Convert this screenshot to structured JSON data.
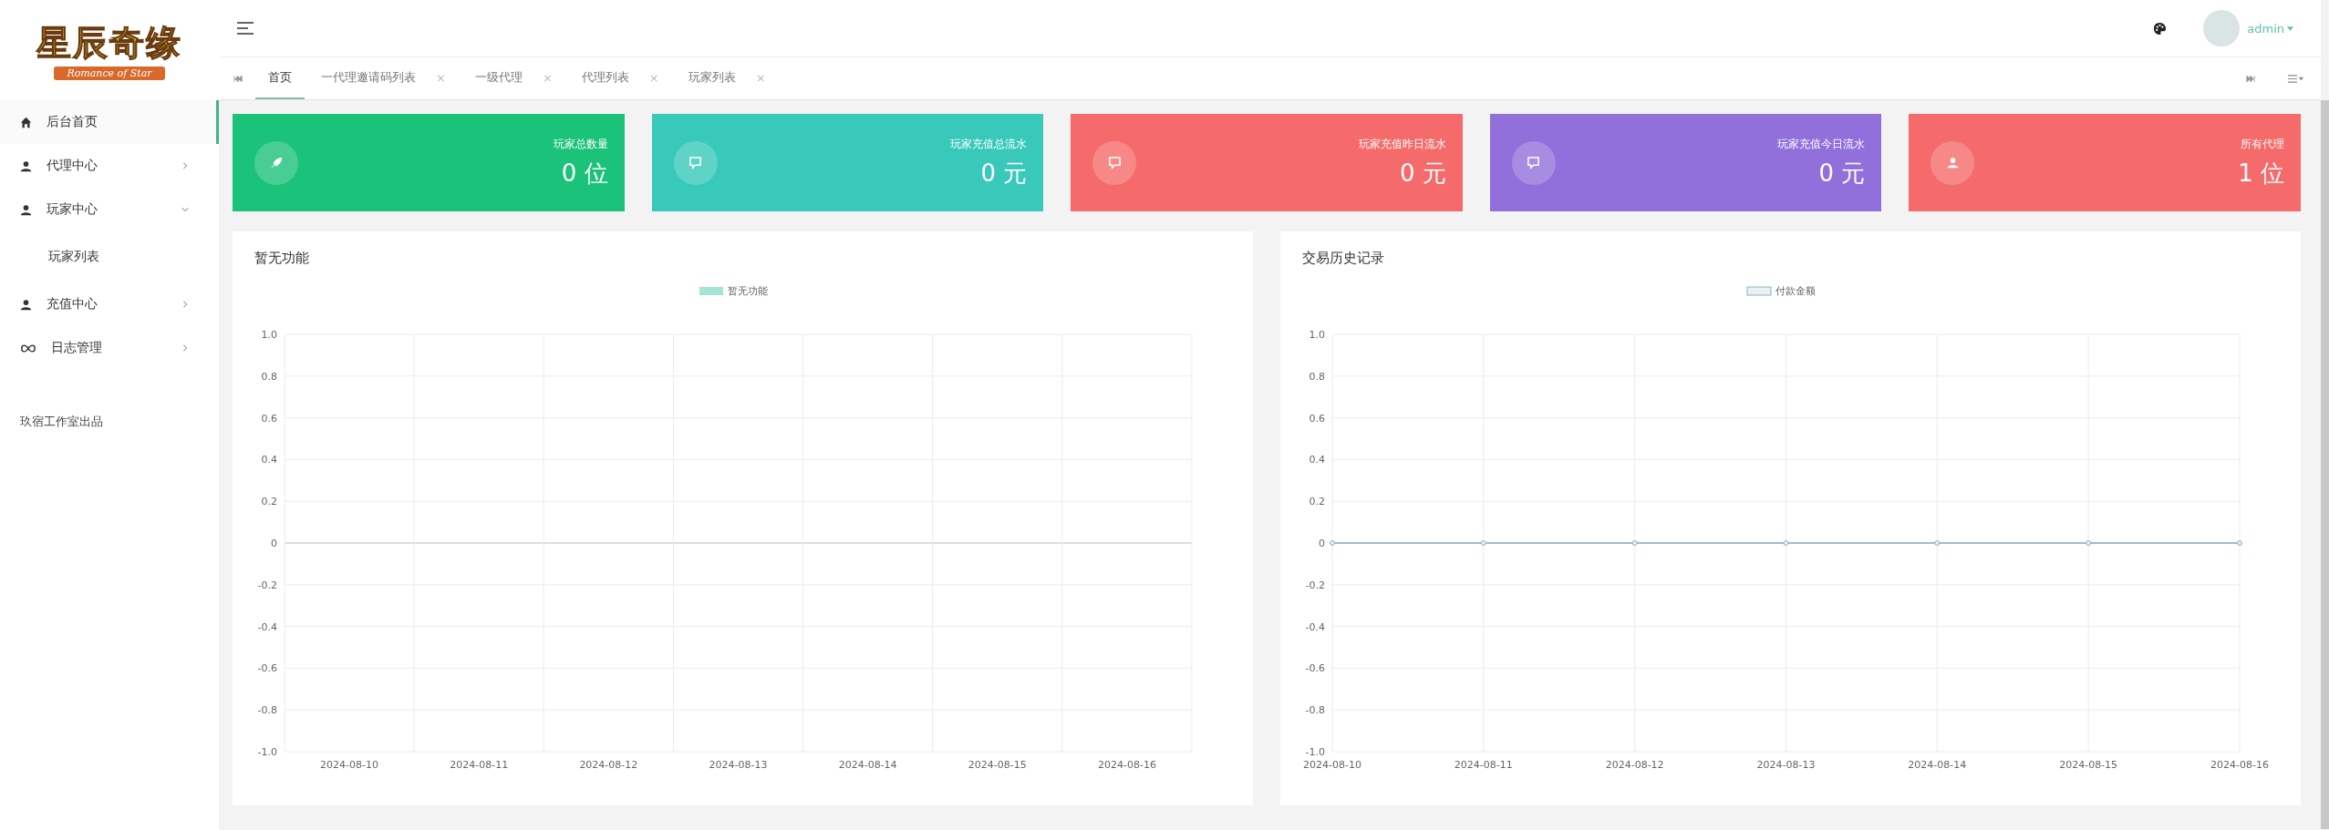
{
  "logo": {
    "title": "星辰奇缘",
    "subtitle": "Romance of Star"
  },
  "sidebar": {
    "items": [
      {
        "label": "后台首页",
        "selected": true
      },
      {
        "label": "代理中心",
        "selected": false,
        "expanded": false
      },
      {
        "label": "玩家中心",
        "selected": false,
        "expanded": true,
        "children": [
          {
            "label": "玩家列表",
            "selected": false
          }
        ]
      },
      {
        "label": "充值中心",
        "selected": false,
        "expanded": false
      },
      {
        "label": "日志管理",
        "selected": false,
        "expanded": false
      }
    ],
    "footer": "玖宿工作室出品"
  },
  "header": {
    "user": "admin"
  },
  "tabs": [
    {
      "label": "首页",
      "selected": true
    },
    {
      "label": "一代理邀请码列表",
      "selected": false,
      "close": "×"
    },
    {
      "label": "一级代理",
      "selected": false,
      "close": "×"
    },
    {
      "label": "代理列表",
      "selected": false,
      "close": "×"
    },
    {
      "label": "玩家列表",
      "selected": false,
      "close": "×"
    }
  ],
  "stats": [
    {
      "label": "玩家总数量",
      "value": "0 位",
      "color": "#1bc27a"
    },
    {
      "label": "玩家充值总流水",
      "value": "0 元",
      "color": "#39c9ba"
    },
    {
      "label": "玩家充值昨日流水",
      "value": "0 元",
      "color": "#f56b6b"
    },
    {
      "label": "玩家充值今日流水",
      "value": "0 元",
      "color": "#9170db"
    },
    {
      "label": "所有代理",
      "value": "1 位",
      "color": "#f56b6b"
    }
  ],
  "panels": [
    {
      "title": "暂无功能",
      "chart_data": {
        "type": "bar",
        "categories": [
          "2024-08-10",
          "2024-08-11",
          "2024-08-12",
          "2024-08-13",
          "2024-08-14",
          "2024-08-15",
          "2024-08-16"
        ],
        "series": [
          {
            "name": "暂无功能",
            "color": "#a3e4d2",
            "values": [
              null,
              null,
              null,
              null,
              null,
              null,
              null
            ]
          }
        ],
        "grid": true,
        "ylim": [
          -1,
          1
        ],
        "yticks": [
          {
            "value": 1,
            "label": "1.0"
          },
          {
            "value": 0.8,
            "label": "0.8"
          },
          {
            "value": 0.6,
            "label": "0.6"
          },
          {
            "value": 0.4,
            "label": "0.4"
          },
          {
            "value": 0.2,
            "label": "0.2"
          },
          {
            "value": 0,
            "label": "0"
          },
          {
            "value": -0.2,
            "label": "-0.2"
          },
          {
            "value": -0.4,
            "label": "-0.4"
          },
          {
            "value": -0.6,
            "label": "-0.6"
          },
          {
            "value": -0.8,
            "label": "-0.8"
          },
          {
            "value": -1,
            "label": "-1.0"
          }
        ]
      }
    },
    {
      "title": "交易历史记录",
      "chart_data": {
        "type": "line",
        "x": [
          "2024-08-10",
          "2024-08-11",
          "2024-08-12",
          "2024-08-13",
          "2024-08-14",
          "2024-08-15",
          "2024-08-16"
        ],
        "series": [
          {
            "name": "付款金额",
            "color": "#8fb0c2",
            "marker": true,
            "values": [
              0,
              0,
              0,
              0,
              0,
              0,
              0
            ]
          }
        ],
        "grid": true,
        "ylim": [
          -1,
          1
        ],
        "yticks": [
          {
            "value": 1,
            "label": "1.0"
          },
          {
            "value": 0.8,
            "label": "0.8"
          },
          {
            "value": 0.6,
            "label": "0.6"
          },
          {
            "value": 0.4,
            "label": "0.4"
          },
          {
            "value": 0.2,
            "label": "0.2"
          },
          {
            "value": 0,
            "label": "0"
          },
          {
            "value": -0.2,
            "label": "-0.2"
          },
          {
            "value": -0.4,
            "label": "-0.4"
          },
          {
            "value": -0.6,
            "label": "-0.6"
          },
          {
            "value": -0.8,
            "label": "-0.8"
          },
          {
            "value": -1,
            "label": "-1.0"
          }
        ]
      }
    }
  ]
}
